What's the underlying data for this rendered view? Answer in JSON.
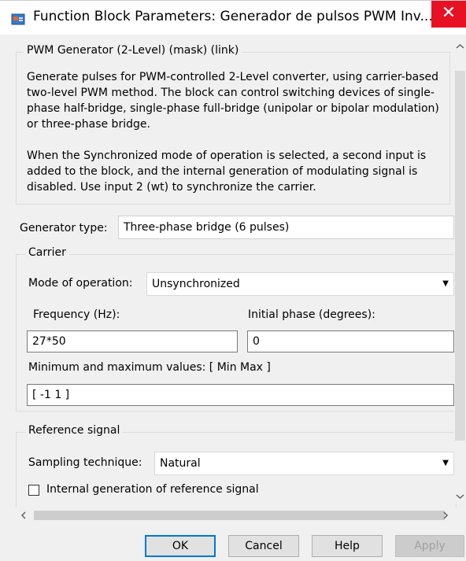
{
  "window": {
    "title": "Function Block Parameters: Generador de pulsos PWM Inv...",
    "close_glyph": "✕"
  },
  "block": {
    "header": "PWM Generator (2-Level) (mask) (link)",
    "description_1": "Generate pulses for PWM-controlled 2-Level converter, using carrier-based two-level PWM method. The block can control switching devices of single-phase half-bridge, single-phase full-bridge (unipolar or bipolar modulation) or three-phase bridge.",
    "description_2": "When the Synchronized mode of operation is selected, a second input is added to the block, and the internal generation of modulating signal is disabled. Use input 2 (wt) to synchronize the carrier."
  },
  "generator": {
    "label": "Generator type:",
    "value": "Three-phase bridge (6 pulses)"
  },
  "carrier": {
    "legend": "Carrier",
    "mode_label": "Mode of operation:",
    "mode_value": "Unsynchronized",
    "frequency_label": "Frequency (Hz):",
    "frequency_value": "27*50",
    "phase_label": "Initial phase (degrees):",
    "phase_value": "0",
    "minmax_label": "Minimum and maximum values: [ Min  Max ]",
    "minmax_value": "[ -1  1 ]"
  },
  "reference": {
    "legend": "Reference signal",
    "sampling_label": "Sampling technique:",
    "sampling_value": "Natural",
    "internal_label": "Internal generation of reference signal",
    "internal_checked": false
  },
  "buttons": {
    "ok": "OK",
    "cancel": "Cancel",
    "help": "Help",
    "apply": "Apply"
  },
  "icons": [
    "block-icon",
    "close-icon",
    "dropdown-arrow-icon",
    "scroll-up-icon",
    "scroll-down-icon",
    "scroll-left-icon",
    "scroll-right-icon"
  ]
}
